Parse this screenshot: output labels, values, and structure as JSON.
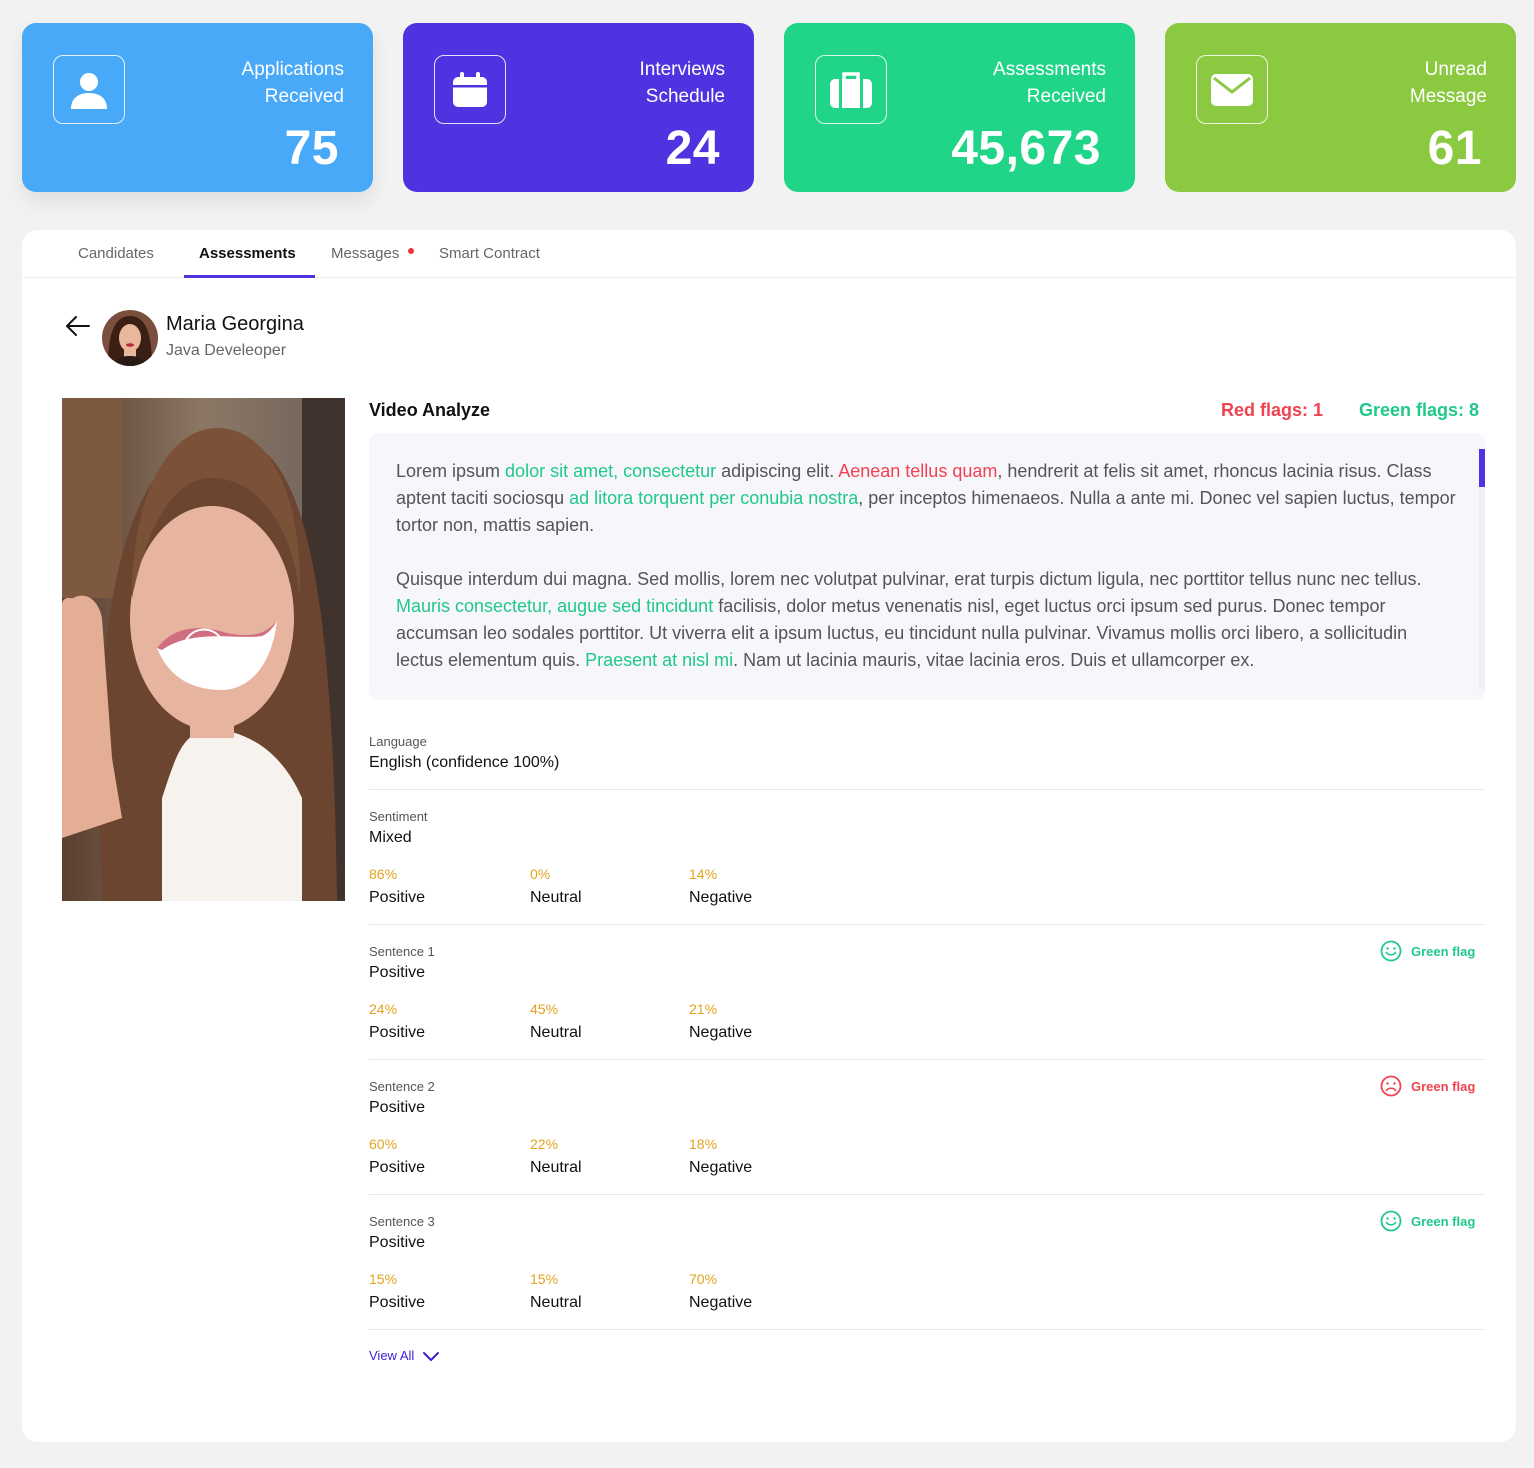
{
  "stats": [
    {
      "label_line1": "Applications",
      "label_line2": "Received",
      "value": "75",
      "icon": "user-icon",
      "color": "#48a9f8"
    },
    {
      "label_line1": "Interviews",
      "label_line2": "Schedule",
      "value": "24",
      "icon": "calendar-icon",
      "color": "#4f33e0"
    },
    {
      "label_line1": "Assessments",
      "label_line2": "Received",
      "value": "45,673",
      "icon": "briefcase-icon",
      "color": "#20d587"
    },
    {
      "label_line1": "Unread",
      "label_line2": "Message",
      "value": "61",
      "icon": "mail-icon",
      "color": "#8bc940"
    }
  ],
  "tabs": [
    "Candidates",
    "Assessments",
    "Messages",
    "Smart Contract"
  ],
  "active_tab": "Assessments",
  "candidate": {
    "name": "Maria Georgina",
    "role": "Java Develeoper"
  },
  "video_analyze": {
    "title": "Video Analyze",
    "red_flags": "Red flags: 1",
    "green_flags": "Green flags: 8",
    "p1": {
      "t1": "Lorem ipsum ",
      "g1": "dolor sit amet, consectetur",
      "t2": " adipiscing elit. ",
      "r1": "Aenean tellus quam",
      "t3": ", hendrerit at felis sit amet, rhoncus lacinia risus. Class aptent taciti sociosqu ",
      "g2": "ad litora torquent per conubia nostra",
      "t4": ", per inceptos himenaeos. Nulla a ante mi. Donec vel sapien luctus, tempor tortor non, mattis sapien."
    },
    "p2": {
      "t1": "Quisque interdum dui magna. Sed mollis, lorem nec volutpat pulvinar, erat turpis dictum ligula, nec porttitor tellus nunc nec tellus. ",
      "g1": "Mauris consectetur, augue sed tincidunt",
      "t2": " facilisis, dolor metus venenatis nisl, eget luctus orci ipsum sed purus. Donec tempor accumsan leo sodales porttitor. Ut viverra elit a ipsum luctus, eu tincidunt nulla pulvinar. Vivamus mollis orci libero, a sollicitudin lectus elementum quis. ",
      "g2": "Praesent at nisl mi",
      "t3": ". Nam ut lacinia mauris, vitae lacinia eros. Duis et ullamcorper ex."
    }
  },
  "language": {
    "label": "Language",
    "value": "English (confidence 100%)"
  },
  "sentiment": {
    "label": "Sentiment",
    "value": "Mixed",
    "positive": "86%",
    "neutral": "0%",
    "negative": "14%"
  },
  "sentences": [
    {
      "label": "Sentence 1",
      "value": "Positive",
      "positive": "24%",
      "neutral": "45%",
      "negative": "21%",
      "flag": "Green flag",
      "flag_type": "happy"
    },
    {
      "label": "Sentence 2",
      "value": "Positive",
      "positive": "60%",
      "neutral": "22%",
      "negative": "18%",
      "flag": "Green flag",
      "flag_type": "sad"
    },
    {
      "label": "Sentence 3",
      "value": "Positive",
      "positive": "15%",
      "neutral": "15%",
      "negative": "70%",
      "flag": "Green flag",
      "flag_type": "happy"
    }
  ],
  "metric_labels": {
    "positive": "Positive",
    "neutral": "Neutral",
    "negative": "Negative"
  },
  "view_all": "View All",
  "colors": {
    "green": "#20c98a",
    "red": "#f04251",
    "accent": "#4f33e0",
    "percent": "#e3a21f"
  }
}
